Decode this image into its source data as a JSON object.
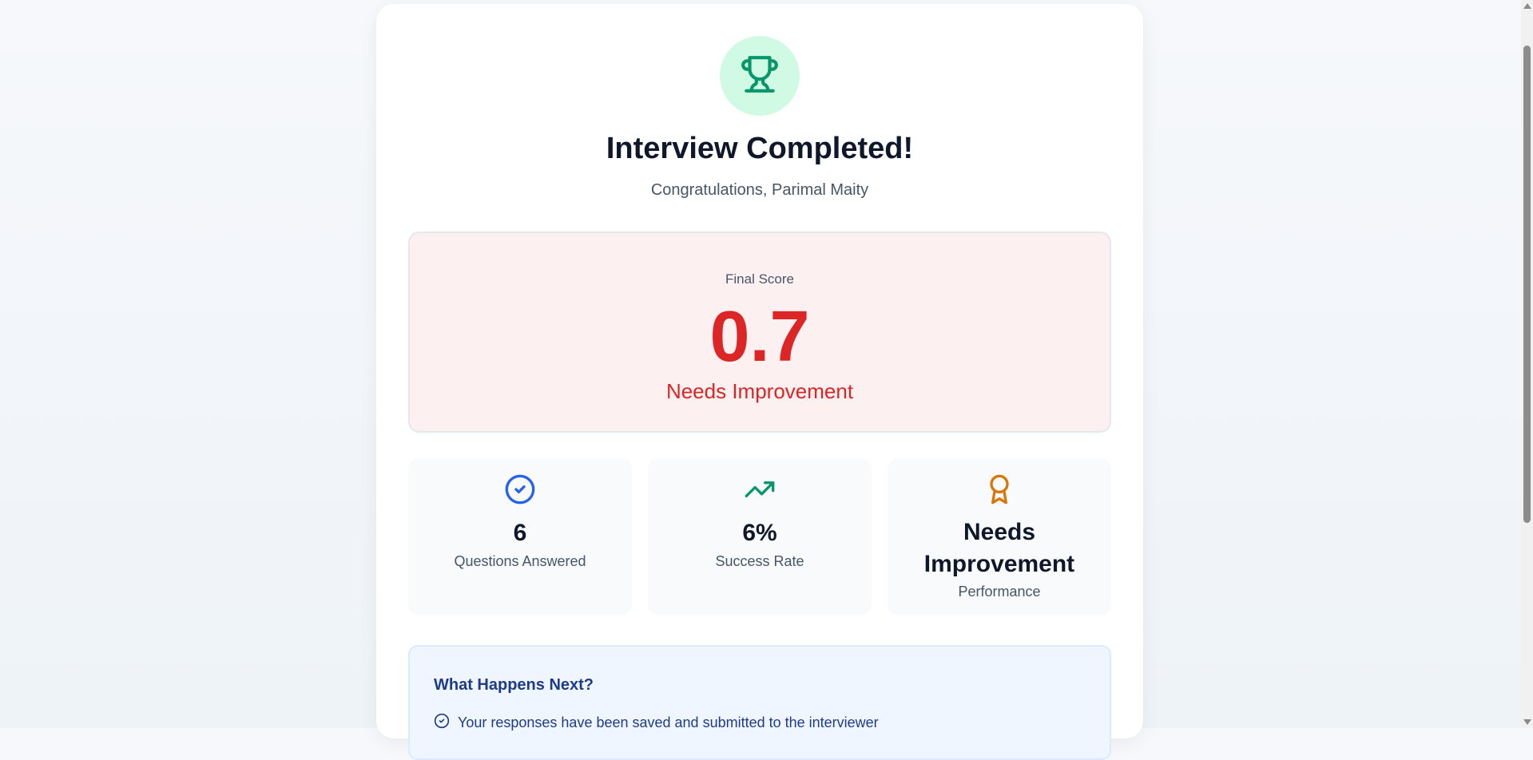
{
  "header": {
    "icon": "trophy-icon",
    "title": "Interview Completed!",
    "subtitle": "Congratulations, Parimal Maity"
  },
  "score": {
    "label": "Final Score",
    "value": "0.7",
    "rating": "Needs Improvement"
  },
  "stats": [
    {
      "icon": "check-circle-icon",
      "value": "6",
      "label": "Questions Answered"
    },
    {
      "icon": "trending-up-icon",
      "value": "6%",
      "label": "Success Rate"
    },
    {
      "icon": "award-icon",
      "value": "Needs Improvement",
      "label": "Performance"
    }
  ],
  "next": {
    "title": "What Happens Next?",
    "items": [
      "Your responses have been saved and submitted to the interviewer"
    ]
  },
  "colors": {
    "success": "#059669",
    "danger": "#dc2626",
    "primary": "#2563eb",
    "warning": "#d97706"
  }
}
